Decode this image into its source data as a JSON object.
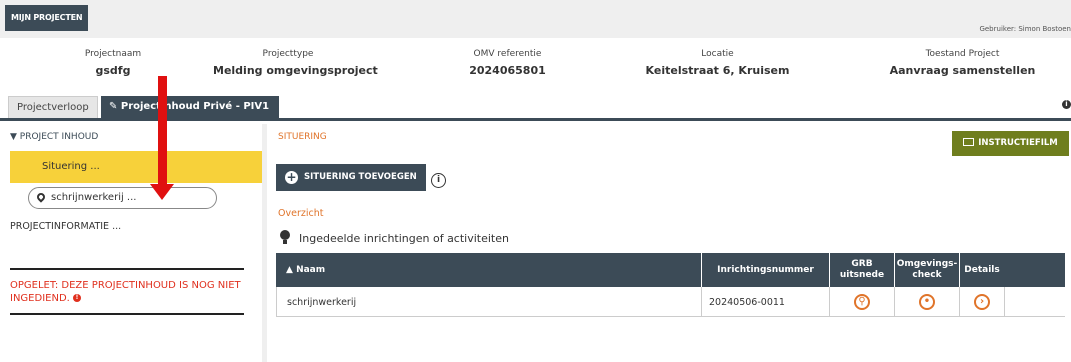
{
  "header": {
    "mijn_projecten": "MIJN PROJECTEN",
    "user": "Gebruiker: Simon Bostoen"
  },
  "project_info": [
    {
      "label": "Projectnaam",
      "value": "gsdfg"
    },
    {
      "label": "Projecttype",
      "value": "Melding omgevingsproject"
    },
    {
      "label": "OMV referentie",
      "value": "2024065801"
    },
    {
      "label": "Locatie",
      "value": "Keitelstraat 6, Kruisem"
    },
    {
      "label": "Toestand Project",
      "value": "Aanvraag samenstellen"
    }
  ],
  "tabs": [
    {
      "label": "Projectverloop"
    },
    {
      "label": "Projectinhoud Privé - PIV1"
    }
  ],
  "sidebar": {
    "head": "PROJECT INHOUD",
    "situering": "Situering ...",
    "pill": "schrijnwerkerij ...",
    "projectinfo": "PROJECTINFORMATIE ...",
    "warning": "OPGELET: DEZE PROJECTINHOUD IS NOG NIET INGEDIEND."
  },
  "main": {
    "title": "SITUERING",
    "instructiefilm": "INSTRUCTIEFILM",
    "add_button": "SITUERING TOEVOEGEN",
    "overzicht": "Overzicht",
    "activities_title": "Ingedeelde inrichtingen of activiteiten"
  },
  "table": {
    "headers": {
      "name": "Naam",
      "nr": "Inrichtingsnummer",
      "grb": "GRB uitsnede",
      "omg": "Omgevings-check",
      "details": "Details"
    },
    "rows": [
      {
        "name": "schrijnwerkerij",
        "nr": "20240506-0011"
      }
    ]
  },
  "colors": {
    "dark": "#3c4b57",
    "accent_orange": "#e0742a",
    "highlight_yellow": "#f7d13a",
    "film_green": "#6f7e1e",
    "warning_red": "#e0301e",
    "annotation_arrow": "#e01010"
  }
}
